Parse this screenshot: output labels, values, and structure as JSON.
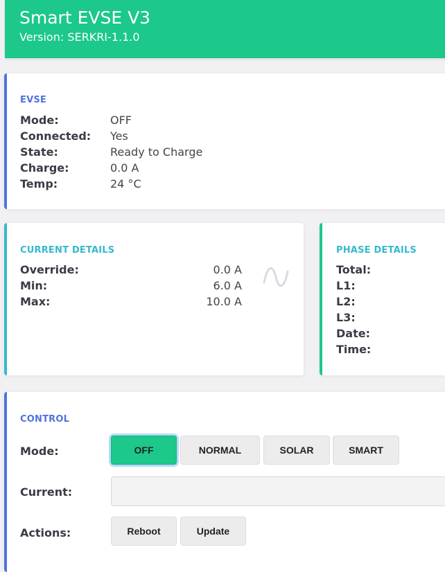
{
  "header": {
    "title": "Smart EVSE V3",
    "version": "Version: SERKRI-1.1.0"
  },
  "evse": {
    "title": "EVSE",
    "rows": [
      {
        "label": "Mode:",
        "value": "OFF"
      },
      {
        "label": "Connected:",
        "value": "Yes"
      },
      {
        "label": "State:",
        "value": "Ready to Charge"
      },
      {
        "label": "Charge:",
        "value": "0.0 A"
      },
      {
        "label": "Temp:",
        "value": "24 °C"
      }
    ]
  },
  "current_details": {
    "title": "CURRENT DETAILS",
    "rows": [
      {
        "label": "Override:",
        "value": "0.0 A"
      },
      {
        "label": "Min:",
        "value": "6.0 A"
      },
      {
        "label": "Max:",
        "value": "10.0 A"
      }
    ],
    "icon": "sine-wave-icon"
  },
  "phase_details": {
    "title": "PHASE DETAILS",
    "rows": [
      {
        "label": "Total:"
      },
      {
        "label": "L1:"
      },
      {
        "label": "L2:"
      },
      {
        "label": "L3:"
      },
      {
        "label": "Date:"
      },
      {
        "label": "Time:"
      }
    ]
  },
  "control": {
    "title": "CONTROL",
    "mode_label": "Mode:",
    "mode_buttons": [
      "OFF",
      "NORMAL",
      "SOLAR",
      "SMART"
    ],
    "active_mode": "OFF",
    "current_label": "Current:",
    "current_value": "",
    "actions_label": "Actions:",
    "action_buttons": [
      "Reboot",
      "Update"
    ]
  },
  "colors": {
    "header": "#1cc88a",
    "primary": "#4e73df",
    "info": "#36b9cc",
    "success": "#1cc88a"
  }
}
